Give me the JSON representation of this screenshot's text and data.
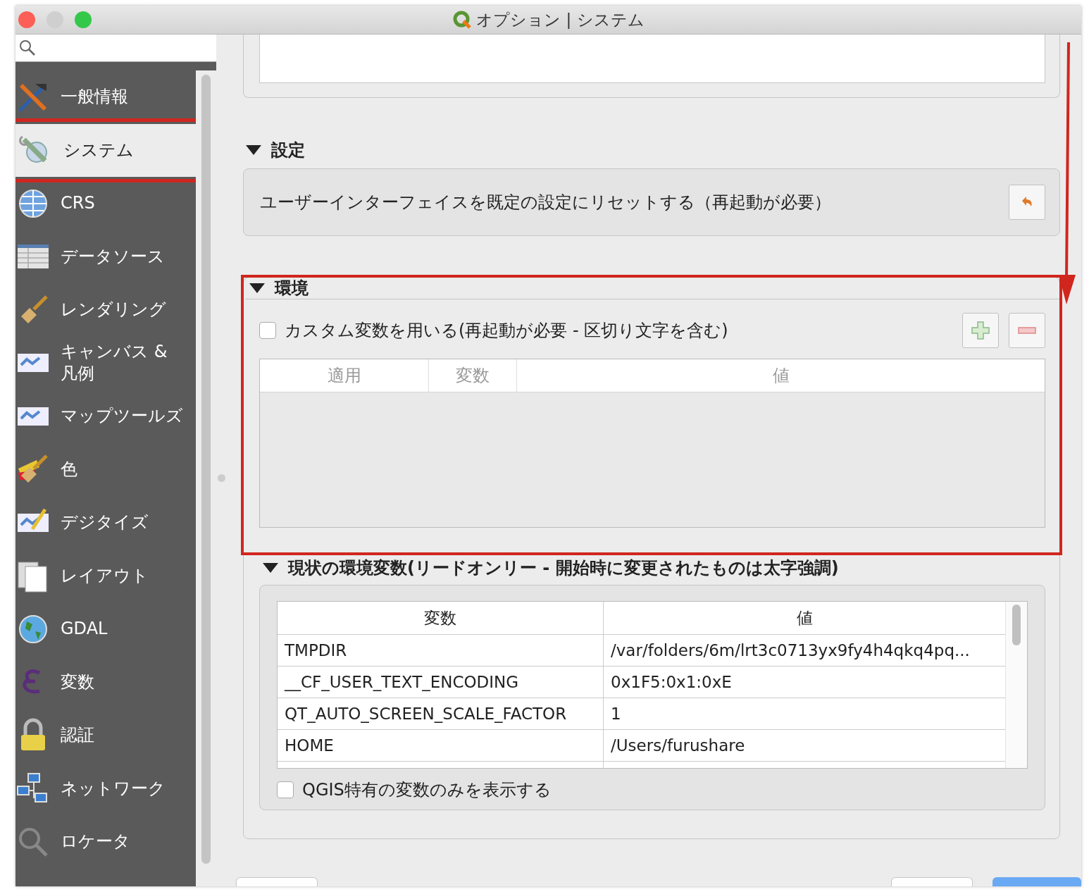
{
  "window": {
    "title": "オプション | システム"
  },
  "sidebar": {
    "items": [
      {
        "label": "一般情報",
        "selected": false,
        "highlighted": false
      },
      {
        "label": "システム",
        "selected": true,
        "highlighted": true
      },
      {
        "label": "CRS",
        "selected": false,
        "highlighted": false
      },
      {
        "label": "データソース",
        "selected": false,
        "highlighted": false
      },
      {
        "label": "レンダリング",
        "selected": false,
        "highlighted": false
      },
      {
        "label": "キャンバス & 凡例",
        "selected": false,
        "highlighted": false
      },
      {
        "label": "マップツールズ",
        "selected": false,
        "highlighted": false
      },
      {
        "label": "色",
        "selected": false,
        "highlighted": false
      },
      {
        "label": "デジタイズ",
        "selected": false,
        "highlighted": false
      },
      {
        "label": "レイアウト",
        "selected": false,
        "highlighted": false
      },
      {
        "label": "GDAL",
        "selected": false,
        "highlighted": false
      },
      {
        "label": "変数",
        "selected": false,
        "highlighted": false
      },
      {
        "label": "認証",
        "selected": false,
        "highlighted": false
      },
      {
        "label": "ネットワーク",
        "selected": false,
        "highlighted": false
      },
      {
        "label": "ロケータ",
        "selected": false,
        "highlighted": false
      }
    ]
  },
  "settings_section": {
    "title": "設定",
    "expanded": true,
    "reset_label": "ユーザーインターフェイスを既定の設定にリセットする（再起動が必要）"
  },
  "environment_section": {
    "title": "環境",
    "expanded": true,
    "highlighted": true,
    "use_custom": {
      "label": "カスタム変数を用いる(再起動が必要 - 区切り文字を含む)",
      "checked": false
    },
    "table": {
      "columns": [
        "適用",
        "変数",
        "値"
      ]
    }
  },
  "current_section": {
    "title": "現状の環境変数(リードオンリー - 開始時に変更されたものは太字強調)",
    "expanded": true,
    "table": {
      "columns": [
        "変数",
        "値"
      ],
      "rows": [
        [
          "TMPDIR",
          "/var/folders/6m/lrt3c0713yx9fy4h4qkq4pq..."
        ],
        [
          "__CF_USER_TEXT_ENCODING",
          "0x1F5:0x1:0xE"
        ],
        [
          "QT_AUTO_SCREEN_SCALE_FACTOR",
          "1"
        ],
        [
          "HOME",
          "/Users/furushare"
        ]
      ]
    },
    "qgis_only": {
      "label": "QGIS特有の変数のみを表示する",
      "checked": false
    }
  }
}
